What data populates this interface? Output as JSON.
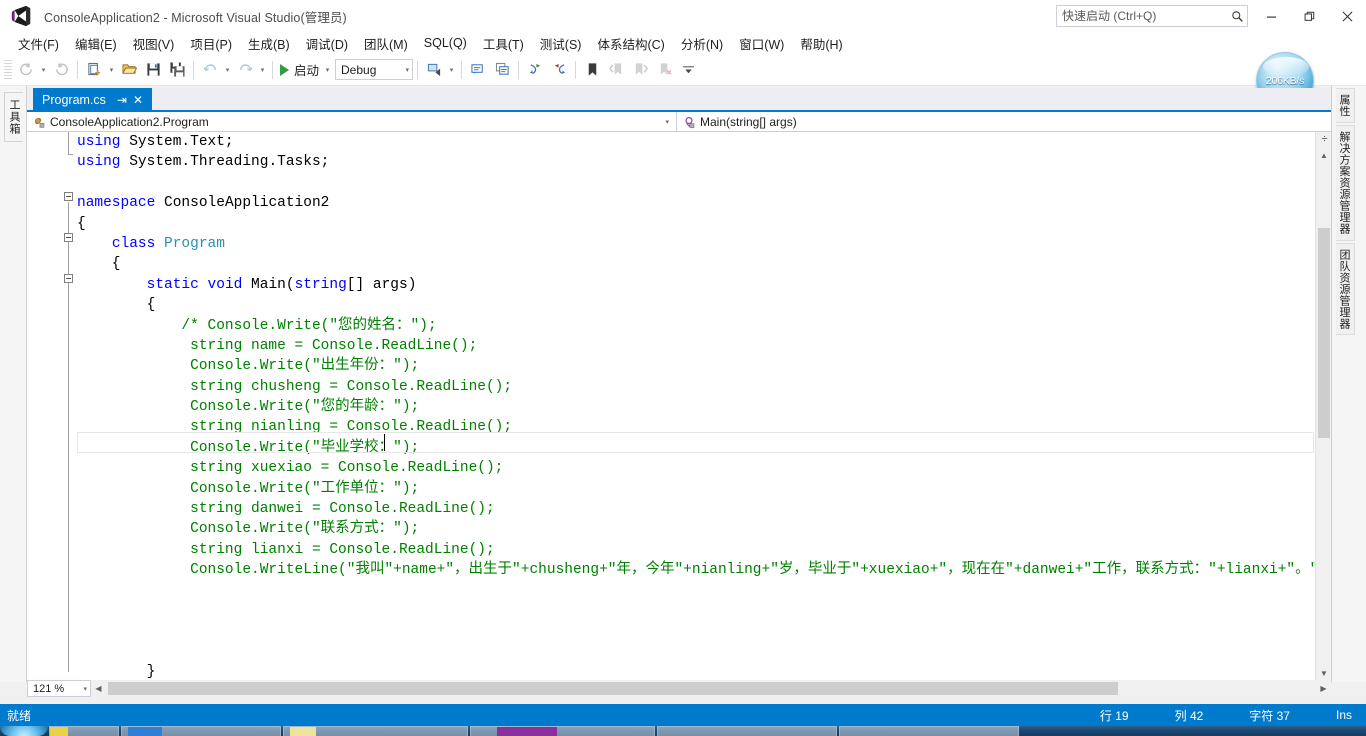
{
  "window": {
    "title": "ConsoleApplication2 - Microsoft Visual Studio(管理员)",
    "logo_icon": "visual-studio-logo-icon",
    "minimize_glyph": "—",
    "restore_glyph": "❐",
    "close_glyph": "✕"
  },
  "quick_launch": {
    "placeholder": "快速启动 (Ctrl+Q)",
    "value": "",
    "icon": "search-icon"
  },
  "menubar": {
    "items": [
      {
        "label": "文件(F)"
      },
      {
        "label": "编辑(E)"
      },
      {
        "label": "视图(V)"
      },
      {
        "label": "项目(P)"
      },
      {
        "label": "生成(B)"
      },
      {
        "label": "调试(D)"
      },
      {
        "label": "团队(M)"
      },
      {
        "label": "SQL(Q)"
      },
      {
        "label": "工具(T)"
      },
      {
        "label": "测试(S)"
      },
      {
        "label": "体系结构(C)"
      },
      {
        "label": "分析(N)"
      },
      {
        "label": "窗口(W)"
      },
      {
        "label": "帮助(H)"
      }
    ]
  },
  "toolbar": {
    "nav_back_icon": "navigate-back-icon",
    "nav_forward_icon": "navigate-forward-icon",
    "new_project_icon": "new-project-icon",
    "open_file_icon": "open-file-icon",
    "save_icon": "save-icon",
    "save_all_icon": "save-all-icon",
    "undo_icon": "undo-icon",
    "redo_icon": "redo-icon",
    "start_label": "启动",
    "start_icon": "play-icon",
    "config_value": "Debug",
    "attach_icon": "attach-to-process-icon",
    "step_icon": "step-icon",
    "comment_icon": "comment-selection-icon",
    "uncomment_icon": "uncomment-selection-icon",
    "indent_icon": "indent-icon",
    "outdent_icon": "outdent-icon",
    "bookmark_icon": "bookmark-icon",
    "bm_prev_icon": "previous-bookmark-icon",
    "bm_next_icon": "next-bookmark-icon",
    "bm_clear_icon": "clear-bookmarks-icon",
    "overflow_icon": "toolbar-overflow-icon"
  },
  "network_monitor": {
    "speed": "206KB/s",
    "caret": "▾"
  },
  "left_rail": {
    "toolbox_label": "工具箱"
  },
  "right_rail": {
    "tabs": [
      {
        "label": "属性"
      },
      {
        "label": "解决方案资源管理器"
      },
      {
        "label": "团队资源管理器"
      }
    ]
  },
  "document_tab": {
    "label": "Program.cs",
    "pin_glyph": "⇥",
    "close_glyph": "✕"
  },
  "navigation": {
    "type_glyph": "class-icon",
    "type_value": "ConsoleApplication2.Program",
    "member_glyph": "method-icon",
    "member_value": "Main(string[] args)",
    "caret": "▾"
  },
  "editor": {
    "lines": [
      {
        "segments": [
          {
            "t": "using",
            "c": "kw"
          },
          {
            "t": " System.Text;",
            "c": ""
          }
        ]
      },
      {
        "segments": [
          {
            "t": "using",
            "c": "kw"
          },
          {
            "t": " System.Threading.Tasks;",
            "c": ""
          }
        ]
      },
      {
        "segments": [
          {
            "t": "",
            "c": ""
          }
        ]
      },
      {
        "segments": [
          {
            "t": "namespace",
            "c": "kw"
          },
          {
            "t": " ConsoleApplication2",
            "c": ""
          }
        ]
      },
      {
        "segments": [
          {
            "t": "{",
            "c": ""
          }
        ]
      },
      {
        "segments": [
          {
            "t": "    ",
            "c": ""
          },
          {
            "t": "class",
            "c": "kw"
          },
          {
            "t": " ",
            "c": ""
          },
          {
            "t": "Program",
            "c": "type"
          }
        ]
      },
      {
        "segments": [
          {
            "t": "    {",
            "c": ""
          }
        ]
      },
      {
        "segments": [
          {
            "t": "        ",
            "c": ""
          },
          {
            "t": "static",
            "c": "kw"
          },
          {
            "t": " ",
            "c": ""
          },
          {
            "t": "void",
            "c": "kw"
          },
          {
            "t": " Main(",
            "c": ""
          },
          {
            "t": "string",
            "c": "kw"
          },
          {
            "t": "[] args)",
            "c": ""
          }
        ]
      },
      {
        "segments": [
          {
            "t": "        {",
            "c": ""
          }
        ]
      },
      {
        "segments": [
          {
            "t": "            /* Console.Write(\"您的姓名：\");",
            "c": "cmt"
          }
        ]
      },
      {
        "segments": [
          {
            "t": "             string name = Console.ReadLine();",
            "c": "cmt"
          }
        ]
      },
      {
        "segments": [
          {
            "t": "             Console.Write(\"出生年份：\");",
            "c": "cmt"
          }
        ]
      },
      {
        "segments": [
          {
            "t": "             string chusheng = Console.ReadLine();",
            "c": "cmt"
          }
        ]
      },
      {
        "segments": [
          {
            "t": "             Console.Write(\"您的年龄：\");",
            "c": "cmt"
          }
        ]
      },
      {
        "segments": [
          {
            "t": "             string nianling = Console.ReadLine();",
            "c": "cmt"
          }
        ]
      },
      {
        "segments": [
          {
            "t": "             Console.Write(\"毕业学校：\");",
            "c": "cmt"
          }
        ]
      },
      {
        "segments": [
          {
            "t": "             string xuexiao = Console.ReadLine();",
            "c": "cmt"
          }
        ]
      },
      {
        "segments": [
          {
            "t": "             Console.Write(\"工作单位：\");",
            "c": "cmt"
          }
        ]
      },
      {
        "segments": [
          {
            "t": "             string danwei = Console.ReadLine();",
            "c": "cmt"
          }
        ]
      },
      {
        "segments": [
          {
            "t": "             Console.Write(\"联系方式：\");",
            "c": "cmt"
          }
        ]
      },
      {
        "segments": [
          {
            "t": "             string lianxi = Console.ReadLine();",
            "c": "cmt"
          }
        ]
      },
      {
        "segments": [
          {
            "t": "             Console.WriteLine(\"我叫\"+name+\"，出生于\"+chusheng+\"年，今年\"+nianling+\"岁，毕业于\"+xuexiao+\"，现在在\"+danwei+\"工作，联系方式：\"+lianxi+\"。\");*/",
            "c": "cmt"
          }
        ]
      },
      {
        "segments": [
          {
            "t": "",
            "c": ""
          }
        ]
      },
      {
        "segments": [
          {
            "t": "",
            "c": ""
          }
        ]
      },
      {
        "segments": [
          {
            "t": "",
            "c": ""
          }
        ]
      },
      {
        "segments": [
          {
            "t": "",
            "c": ""
          }
        ]
      },
      {
        "segments": [
          {
            "t": "        }",
            "c": ""
          }
        ]
      }
    ]
  },
  "zoom_control": {
    "value": "121 %",
    "caret": "▾"
  },
  "scrollbars": {
    "up_glyph": "▲",
    "down_glyph": "▼",
    "left_glyph": "◀",
    "right_glyph": "▶",
    "split_glyph": "÷"
  },
  "statusbar": {
    "ready": "就绪",
    "line_label": "行 19",
    "col_label": "列 42",
    "char_label": "字符 37",
    "insert_mode": "Ins"
  },
  "colors": {
    "accent": "#007acc",
    "keyword": "#0000ff",
    "type": "#2b91af",
    "comment": "#008000",
    "titlebar_bg": "#ffffff"
  }
}
